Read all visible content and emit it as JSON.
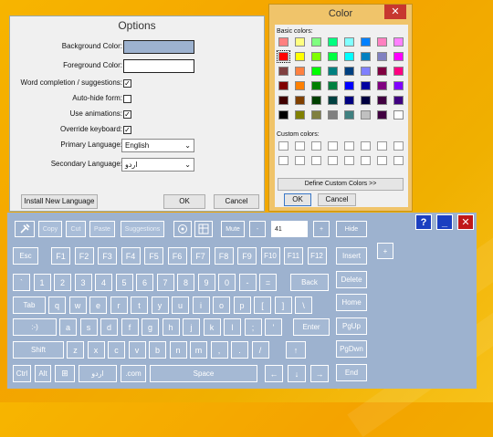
{
  "options": {
    "title": "Options",
    "labels": {
      "bg": "Background Color:",
      "fg": "Foreground Color:",
      "word": "Word completion / suggestions:",
      "autohide": "Auto-hide form:",
      "anim": "Use animations:",
      "override": "Override keyboard:",
      "primary": "Primary Language:",
      "secondary": "Secondary Language:"
    },
    "bg_color": "#9db2cf",
    "fg_color": "#ffffff",
    "checks": {
      "word": "✓",
      "autohide": "",
      "anim": "✓",
      "override": "✓"
    },
    "primary_value": "English",
    "secondary_value": "اردو",
    "install_label": "Install New Language",
    "ok_label": "OK",
    "cancel_label": "Cancel"
  },
  "color_dialog": {
    "title": "Color",
    "close": "✕",
    "basic_label": "Basic colors:",
    "custom_label": "Custom colors:",
    "define_label": "Define Custom Colors >>",
    "ok_label": "OK",
    "cancel_label": "Cancel",
    "basic_colors": [
      [
        "#ff8080",
        "#ffff80",
        "#80ff80",
        "#00ff80",
        "#80ffff",
        "#0080ff",
        "#ff80c0",
        "#ff80ff"
      ],
      [
        "#ff0000",
        "#ffff00",
        "#80ff00",
        "#00ff40",
        "#00ffff",
        "#0080c0",
        "#8080c0",
        "#ff00ff"
      ],
      [
        "#804040",
        "#ff8040",
        "#00ff00",
        "#008080",
        "#004080",
        "#8080ff",
        "#800040",
        "#ff0080"
      ],
      [
        "#800000",
        "#ff8000",
        "#008000",
        "#008040",
        "#0000ff",
        "#0000a0",
        "#800080",
        "#8000ff"
      ],
      [
        "#400000",
        "#804000",
        "#004000",
        "#004040",
        "#000080",
        "#000040",
        "#400040",
        "#400080"
      ],
      [
        "#000000",
        "#808000",
        "#808040",
        "#808080",
        "#408080",
        "#c0c0c0",
        "#400040",
        "#ffffff"
      ]
    ],
    "selected": "#ff0000"
  },
  "keyboard": {
    "bg": "#9db2cf",
    "toolbar": {
      "tools_icon": "tools-icon",
      "copy": "Copy",
      "cut": "Cut",
      "paste": "Paste",
      "suggestions": "Suggestions",
      "mute": "Mute",
      "minus": "-",
      "size_value": "41",
      "plus": "+",
      "hide": "Hide",
      "help": "?",
      "minimize": "_",
      "close": "✕"
    },
    "rows": [
      [
        "Esc",
        "F1",
        "F2",
        "F3",
        "F4",
        "F5",
        "F6",
        "F7",
        "F8",
        "F9",
        "F10",
        "F11",
        "F12"
      ],
      [
        "`",
        "1",
        "2",
        "3",
        "4",
        "5",
        "6",
        "7",
        "8",
        "9",
        "0",
        "-",
        "=",
        "Back"
      ],
      [
        "Tab",
        "q",
        "w",
        "e",
        "r",
        "t",
        "y",
        "u",
        "i",
        "o",
        "p",
        "[",
        "]",
        "\\"
      ],
      [
        ":-)",
        "a",
        "s",
        "d",
        "f",
        "g",
        "h",
        "j",
        "k",
        "l",
        ";",
        "'",
        "Enter"
      ],
      [
        "Shift",
        "z",
        "x",
        "c",
        "v",
        "b",
        "n",
        "m",
        ",",
        ".",
        "/",
        "↑"
      ],
      [
        "Ctrl",
        "Alt",
        "اردو",
        ".com",
        "Space",
        "←",
        "↓",
        "→"
      ]
    ],
    "side": [
      "Insert",
      "Delete",
      "Home",
      "PgUp",
      "PgDwn",
      "End"
    ],
    "plus_side": "+"
  }
}
